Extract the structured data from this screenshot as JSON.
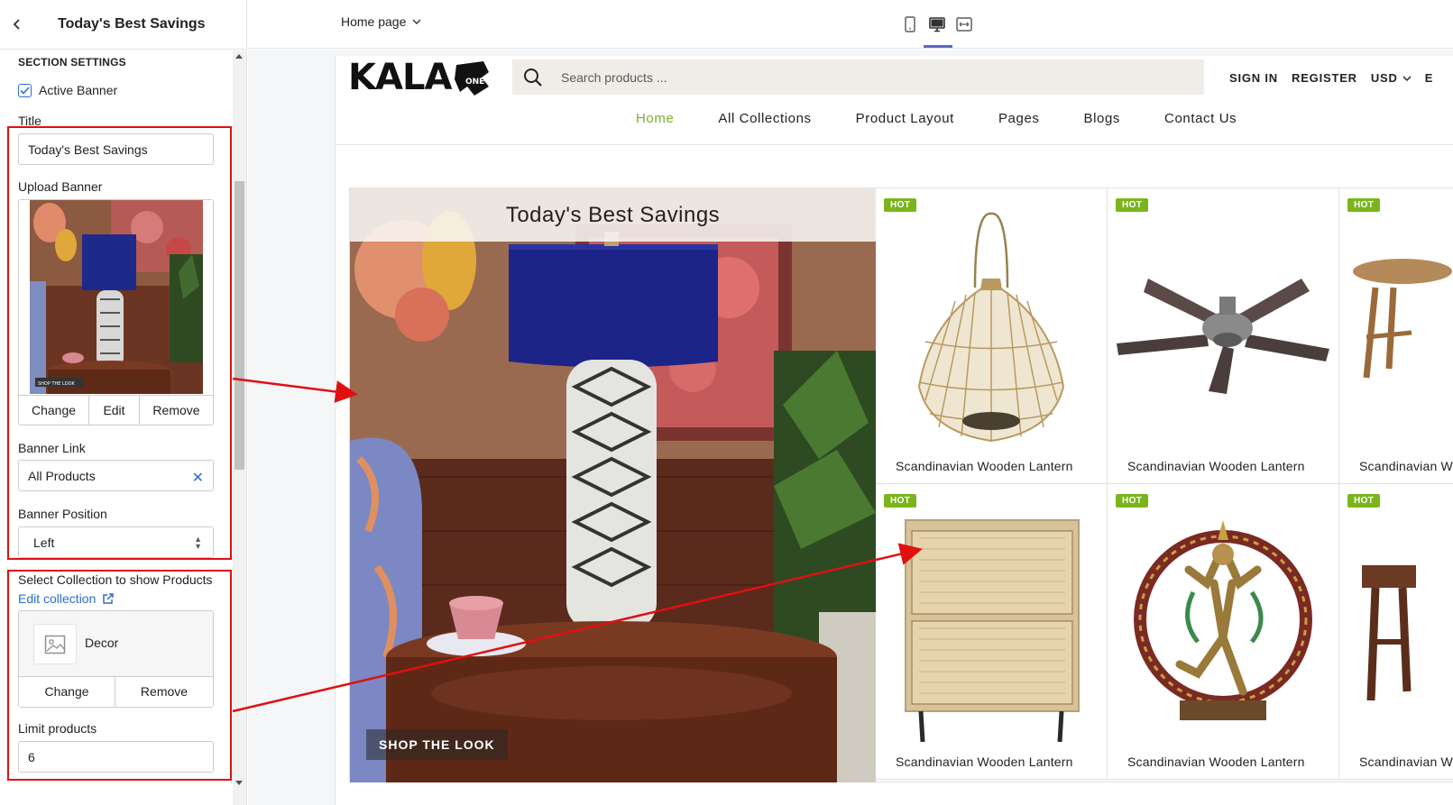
{
  "sidebar": {
    "title": "Today's Best Savings",
    "section_heading": "SECTION SETTINGS",
    "active_banner_label": "Active Banner",
    "active_banner_checked": true,
    "title_label": "Title",
    "title_value": "Today's Best Savings",
    "upload_banner_label": "Upload Banner",
    "banner_buttons": [
      "Change",
      "Edit",
      "Remove"
    ],
    "thumb_caption": "SHOP THE LOOK",
    "banner_link_label": "Banner Link",
    "banner_link_value": "All Products",
    "banner_position_label": "Banner Position",
    "banner_position_value": "Left",
    "select_collection_label": "Select Collection to show Products",
    "edit_collection_link": "Edit collection",
    "collection_name": "Decor",
    "collection_buttons": [
      "Change",
      "Remove"
    ],
    "limit_label": "Limit products",
    "limit_value": "6"
  },
  "topbar": {
    "page_select": "Home page",
    "views": [
      "mobile-view-icon",
      "desktop-view-icon",
      "fullwidth-view-icon"
    ],
    "active_view": "desktop"
  },
  "store": {
    "search_placeholder": "Search products ...",
    "account": [
      "SIGN IN",
      "REGISTER",
      "USD",
      "E"
    ],
    "nav": [
      "Home",
      "All Collections",
      "Product Layout",
      "Pages",
      "Blogs",
      "Contact Us"
    ],
    "active_nav": "Home",
    "accent_color": "#7ab030",
    "section": {
      "banner_title": "Today's Best Savings",
      "banner_cta": "SHOP THE LOOK",
      "products": [
        {
          "badge": "HOT",
          "name": "Scandinavian Wooden Lantern"
        },
        {
          "badge": "HOT",
          "name": "Scandinavian Wooden Lantern"
        },
        {
          "badge": "HOT",
          "name": "Scandinavian Wooden Lantern"
        },
        {
          "badge": "HOT",
          "name": "Scandinavian Wooden Lantern"
        },
        {
          "badge": "HOT",
          "name": "Scandinavian Wooden Lantern"
        },
        {
          "badge": "HOT",
          "name": "Scandinavian Wooden Lantern"
        }
      ]
    }
  }
}
